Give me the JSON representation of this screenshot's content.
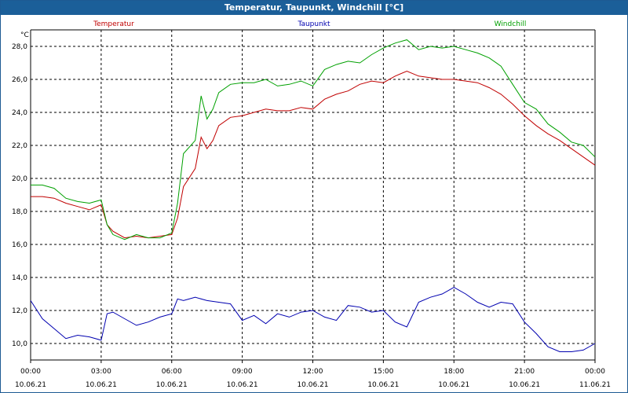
{
  "window": {
    "title": "Temperatur, Taupunkt, Windchill [°C]"
  },
  "chart_data": {
    "type": "line",
    "title": "Temperatur, Taupunkt, Windchill [°C]",
    "ylabel": "°C",
    "ylim": [
      9.0,
      29.0
    ],
    "yticks": [
      "10,0",
      "12,0",
      "14,0",
      "16,0",
      "18,0",
      "20,0",
      "22,0",
      "24,0",
      "26,0",
      "28,0"
    ],
    "xlim_hours": [
      0,
      24
    ],
    "xticks": [
      {
        "time": "00:00",
        "date": "10.06.21"
      },
      {
        "time": "03:00",
        "date": "10.06.21"
      },
      {
        "time": "06:00",
        "date": "10.06.21"
      },
      {
        "time": "09:00",
        "date": "10.06.21"
      },
      {
        "time": "12:00",
        "date": "10.06.21"
      },
      {
        "time": "15:00",
        "date": "10.06.21"
      },
      {
        "time": "18:00",
        "date": "10.06.21"
      },
      {
        "time": "21:00",
        "date": "10.06.21"
      },
      {
        "time": "00:00",
        "date": "11.06.21"
      }
    ],
    "grid": true,
    "legend_position": "top",
    "series": [
      {
        "name": "Temperatur",
        "color": "#c00000",
        "x": [
          0,
          0.5,
          1,
          1.5,
          2,
          2.5,
          3,
          3.25,
          3.5,
          4,
          4.5,
          5,
          5.5,
          6,
          6.25,
          6.5,
          7,
          7.25,
          7.5,
          7.75,
          8,
          8.5,
          9,
          9.5,
          10,
          10.5,
          11,
          11.5,
          12,
          12.5,
          13,
          13.5,
          14,
          14.5,
          15,
          15.5,
          16,
          16.5,
          17,
          17.5,
          18,
          18.5,
          19,
          19.5,
          20,
          20.5,
          21,
          21.5,
          22,
          22.5,
          23,
          23.5,
          24
        ],
        "y": [
          18.9,
          18.9,
          18.8,
          18.5,
          18.3,
          18.1,
          18.4,
          17.2,
          16.8,
          16.4,
          16.5,
          16.4,
          16.5,
          16.6,
          17.6,
          19.5,
          20.6,
          22.5,
          21.8,
          22.3,
          23.2,
          23.7,
          23.8,
          24.0,
          24.2,
          24.1,
          24.1,
          24.3,
          24.2,
          24.8,
          25.1,
          25.3,
          25.7,
          25.9,
          25.8,
          26.2,
          26.5,
          26.2,
          26.1,
          26.0,
          26.0,
          25.9,
          25.8,
          25.5,
          25.1,
          24.5,
          23.8,
          23.2,
          22.7,
          22.3,
          21.8,
          21.3,
          20.8
        ]
      },
      {
        "name": "Taupunkt",
        "color": "#0000b0",
        "x": [
          0,
          0.5,
          1,
          1.5,
          2,
          2.5,
          3,
          3.25,
          3.5,
          4,
          4.5,
          5,
          5.5,
          6,
          6.25,
          6.5,
          7,
          7.5,
          8,
          8.5,
          9,
          9.5,
          10,
          10.5,
          11,
          11.5,
          12,
          12.5,
          13,
          13.5,
          14,
          14.5,
          15,
          15.5,
          16,
          16.5,
          17,
          17.5,
          18,
          18.5,
          19,
          19.5,
          20,
          20.5,
          21,
          21.5,
          22,
          22.5,
          23,
          23.5,
          24
        ],
        "y": [
          12.6,
          11.5,
          10.9,
          10.3,
          10.5,
          10.4,
          10.2,
          11.8,
          11.9,
          11.5,
          11.1,
          11.3,
          11.6,
          11.8,
          12.7,
          12.6,
          12.8,
          12.6,
          12.5,
          12.4,
          11.4,
          11.7,
          11.2,
          11.8,
          11.6,
          11.9,
          12.0,
          11.6,
          11.4,
          12.3,
          12.2,
          11.9,
          12.0,
          11.3,
          11.0,
          12.5,
          12.8,
          13.0,
          13.4,
          13.0,
          12.5,
          12.2,
          12.5,
          12.4,
          11.3,
          10.6,
          9.8,
          9.5,
          9.5,
          9.6,
          10.0
        ]
      },
      {
        "name": "Windchill",
        "color": "#00a000",
        "x": [
          0,
          0.5,
          1,
          1.5,
          2,
          2.5,
          3,
          3.25,
          3.5,
          4,
          4.5,
          5,
          5.5,
          6,
          6.25,
          6.5,
          7,
          7.25,
          7.5,
          7.75,
          8,
          8.5,
          9,
          9.5,
          10,
          10.5,
          11,
          11.5,
          12,
          12.5,
          13,
          13.5,
          14,
          14.5,
          15,
          15.5,
          16,
          16.5,
          17,
          17.5,
          18,
          18.5,
          19,
          19.5,
          20,
          20.5,
          21,
          21.5,
          22,
          22.5,
          23,
          23.5,
          24
        ],
        "y": [
          19.6,
          19.6,
          19.4,
          18.8,
          18.6,
          18.5,
          18.7,
          17.2,
          16.6,
          16.3,
          16.6,
          16.4,
          16.4,
          16.7,
          18.5,
          21.5,
          22.3,
          25.0,
          23.6,
          24.2,
          25.2,
          25.7,
          25.8,
          25.8,
          26.0,
          25.6,
          25.7,
          25.9,
          25.6,
          26.6,
          26.9,
          27.1,
          27.0,
          27.5,
          27.9,
          28.2,
          28.4,
          27.8,
          28.0,
          27.9,
          28.0,
          27.8,
          27.6,
          27.3,
          26.8,
          25.7,
          24.6,
          24.2,
          23.3,
          22.8,
          22.2,
          22.0,
          21.3
        ]
      }
    ]
  }
}
